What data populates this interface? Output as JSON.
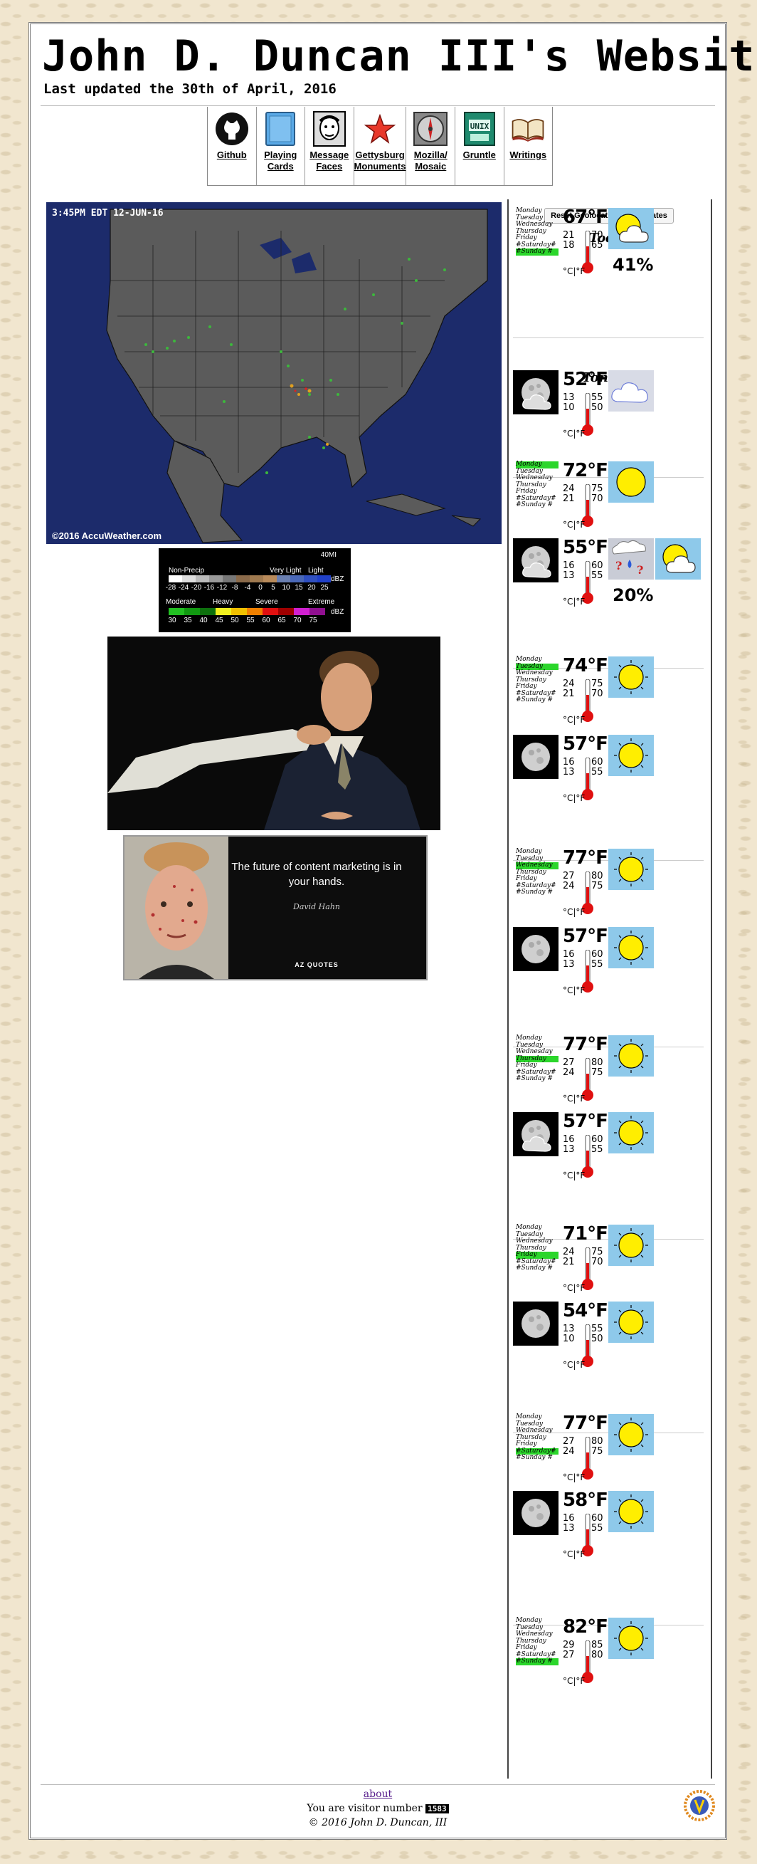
{
  "site": {
    "title": "John D. Duncan III's Website",
    "updated": "Last updated the 30th of April, 2016"
  },
  "nav": [
    {
      "label": "Github",
      "icon": "github-icon"
    },
    {
      "label": "Playing Cards",
      "icon": "playing-cards-icon"
    },
    {
      "label": "Message Faces",
      "icon": "message-faces-icon"
    },
    {
      "label": "Gettysburg Monuments",
      "icon": "star-icon"
    },
    {
      "label": "Mozilla/ Mosaic",
      "icon": "compass-icon"
    },
    {
      "label": "Gruntle",
      "icon": "unix-book-icon"
    },
    {
      "label": "Writings",
      "icon": "book-icon"
    }
  ],
  "radar": {
    "timestamp": "3:45PM EDT 12-JUN-16",
    "copyright": "©2016 AccuWeather.com",
    "legend": {
      "scale": "40MI",
      "top_labels": [
        "Non-Precip",
        "Very Light",
        "Light"
      ],
      "top_ticks": [
        "-28",
        "-24",
        "-20",
        "-16",
        "-12",
        "-8",
        "-4",
        "0",
        "5",
        "10",
        "15",
        "20",
        "25"
      ],
      "bottom_labels": [
        "Moderate",
        "Heavy",
        "Severe",
        "Extreme"
      ],
      "bottom_ticks": [
        "30",
        "35",
        "40",
        "45",
        "50",
        "55",
        "60",
        "65",
        "70",
        "75"
      ],
      "unit": "dBZ"
    }
  },
  "quote": {
    "text": "The future of content marketing is in your hands.",
    "author": "David Hahn",
    "brand": "AZ QUOTES"
  },
  "weather": {
    "reset_button": "Reset Geolocation Coordinates",
    "today_label": "Today",
    "tonight_label": "Tonight",
    "unit_label": "°C|°F",
    "days": [
      "Monday",
      "Tuesday",
      "Wednesday",
      "Thursday",
      "Friday",
      "#Saturday#",
      "#Sunday #"
    ],
    "periods": [
      {
        "type": "day",
        "temp": "67°F",
        "c_hi": "21",
        "f_hi": "70",
        "c_lo": "18",
        "f_lo": "65",
        "icon": "partly-cloudy-icon",
        "pct": "41%",
        "hl": 6
      },
      {
        "type": "night",
        "temp": "52°F",
        "c_hi": "13",
        "f_hi": "55",
        "c_lo": "10",
        "f_lo": "50",
        "icon": "cloudy-icon",
        "pct": ""
      },
      {
        "type": "day",
        "temp": "72°F",
        "c_hi": "24",
        "f_hi": "75",
        "c_lo": "21",
        "f_lo": "70",
        "icon": "partly-sunny-icon",
        "pct": "",
        "hl": 0
      },
      {
        "type": "night",
        "temp": "55°F",
        "c_hi": "16",
        "f_hi": "60",
        "c_lo": "13",
        "f_lo": "55",
        "icon": "rain-icon",
        "pct": "20%"
      },
      {
        "type": "day",
        "temp": "74°F",
        "c_hi": "24",
        "f_hi": "75",
        "c_lo": "21",
        "f_lo": "70",
        "icon": "sunny-icon",
        "pct": "",
        "hl": 1
      },
      {
        "type": "night",
        "temp": "57°F",
        "c_hi": "16",
        "f_hi": "60",
        "c_lo": "13",
        "f_lo": "55",
        "icon": "clear-night-icon",
        "pct": ""
      },
      {
        "type": "day",
        "temp": "77°F",
        "c_hi": "27",
        "f_hi": "80",
        "c_lo": "24",
        "f_lo": "75",
        "icon": "sunny-icon",
        "pct": "",
        "hl": 2
      },
      {
        "type": "night",
        "temp": "57°F",
        "c_hi": "16",
        "f_hi": "60",
        "c_lo": "13",
        "f_lo": "55",
        "icon": "clear-night-icon",
        "pct": ""
      },
      {
        "type": "day",
        "temp": "77°F",
        "c_hi": "27",
        "f_hi": "80",
        "c_lo": "24",
        "f_lo": "75",
        "icon": "sunny-icon",
        "pct": "",
        "hl": 3
      },
      {
        "type": "night",
        "temp": "57°F",
        "c_hi": "16",
        "f_hi": "60",
        "c_lo": "13",
        "f_lo": "55",
        "icon": "partly-cloudy-night-icon",
        "pct": ""
      },
      {
        "type": "day",
        "temp": "71°F",
        "c_hi": "24",
        "f_hi": "75",
        "c_lo": "21",
        "f_lo": "70",
        "icon": "sunny-icon",
        "pct": "",
        "hl": 4
      },
      {
        "type": "night",
        "temp": "54°F",
        "c_hi": "13",
        "f_hi": "55",
        "c_lo": "10",
        "f_lo": "50",
        "icon": "clear-night-icon",
        "pct": ""
      },
      {
        "type": "day",
        "temp": "77°F",
        "c_hi": "27",
        "f_hi": "80",
        "c_lo": "24",
        "f_lo": "75",
        "icon": "sunny-icon",
        "pct": "",
        "hl": 5
      },
      {
        "type": "night",
        "temp": "58°F",
        "c_hi": "16",
        "f_hi": "60",
        "c_lo": "13",
        "f_lo": "55",
        "icon": "clear-night-icon",
        "pct": ""
      },
      {
        "type": "day",
        "temp": "82°F",
        "c_hi": "29",
        "f_hi": "85",
        "c_lo": "27",
        "f_lo": "80",
        "icon": "sunny-icon",
        "pct": "",
        "hl": 6
      }
    ]
  },
  "footer": {
    "about": "about",
    "visitor_prefix": "You are visitor number",
    "visitor_count": "1583",
    "copyright": "© 2016 John D. Duncan, III"
  },
  "colors": {
    "background": "#f1e6cf",
    "sky": "#8ec9ea",
    "sun": "#ffee00",
    "mercury": "#e01010",
    "day_highlight": "#2bd62b"
  }
}
